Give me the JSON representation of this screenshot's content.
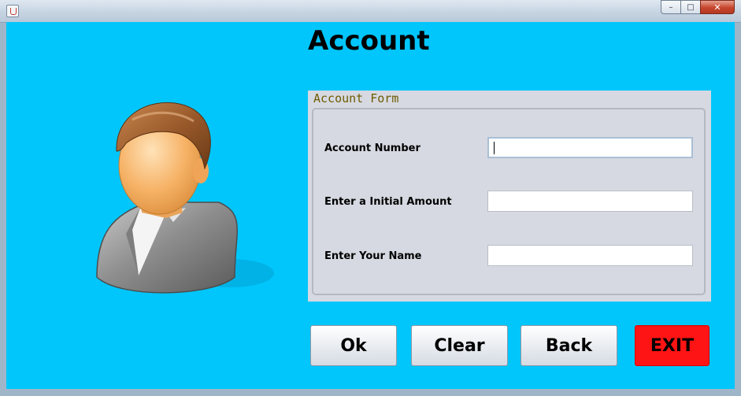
{
  "window": {
    "minimize_glyph": "–",
    "maximize_glyph": "□",
    "close_glyph": "✕"
  },
  "page": {
    "title": "Account"
  },
  "form": {
    "legend": "Account Form",
    "fields": [
      {
        "label": "Account Number",
        "value": ""
      },
      {
        "label": "Enter a Initial Amount",
        "value": ""
      },
      {
        "label": "Enter Your Name",
        "value": ""
      }
    ]
  },
  "buttons": {
    "ok": "Ok",
    "clear": "Clear",
    "back": "Back",
    "exit": "EXIT"
  },
  "colors": {
    "background": "#00c6fc",
    "panel": "#d6d9e1",
    "legend": "#6e5b00",
    "exit_button": "#fe1414"
  },
  "icons": {
    "avatar": "user-avatar-icon",
    "app": "java-app-icon"
  }
}
